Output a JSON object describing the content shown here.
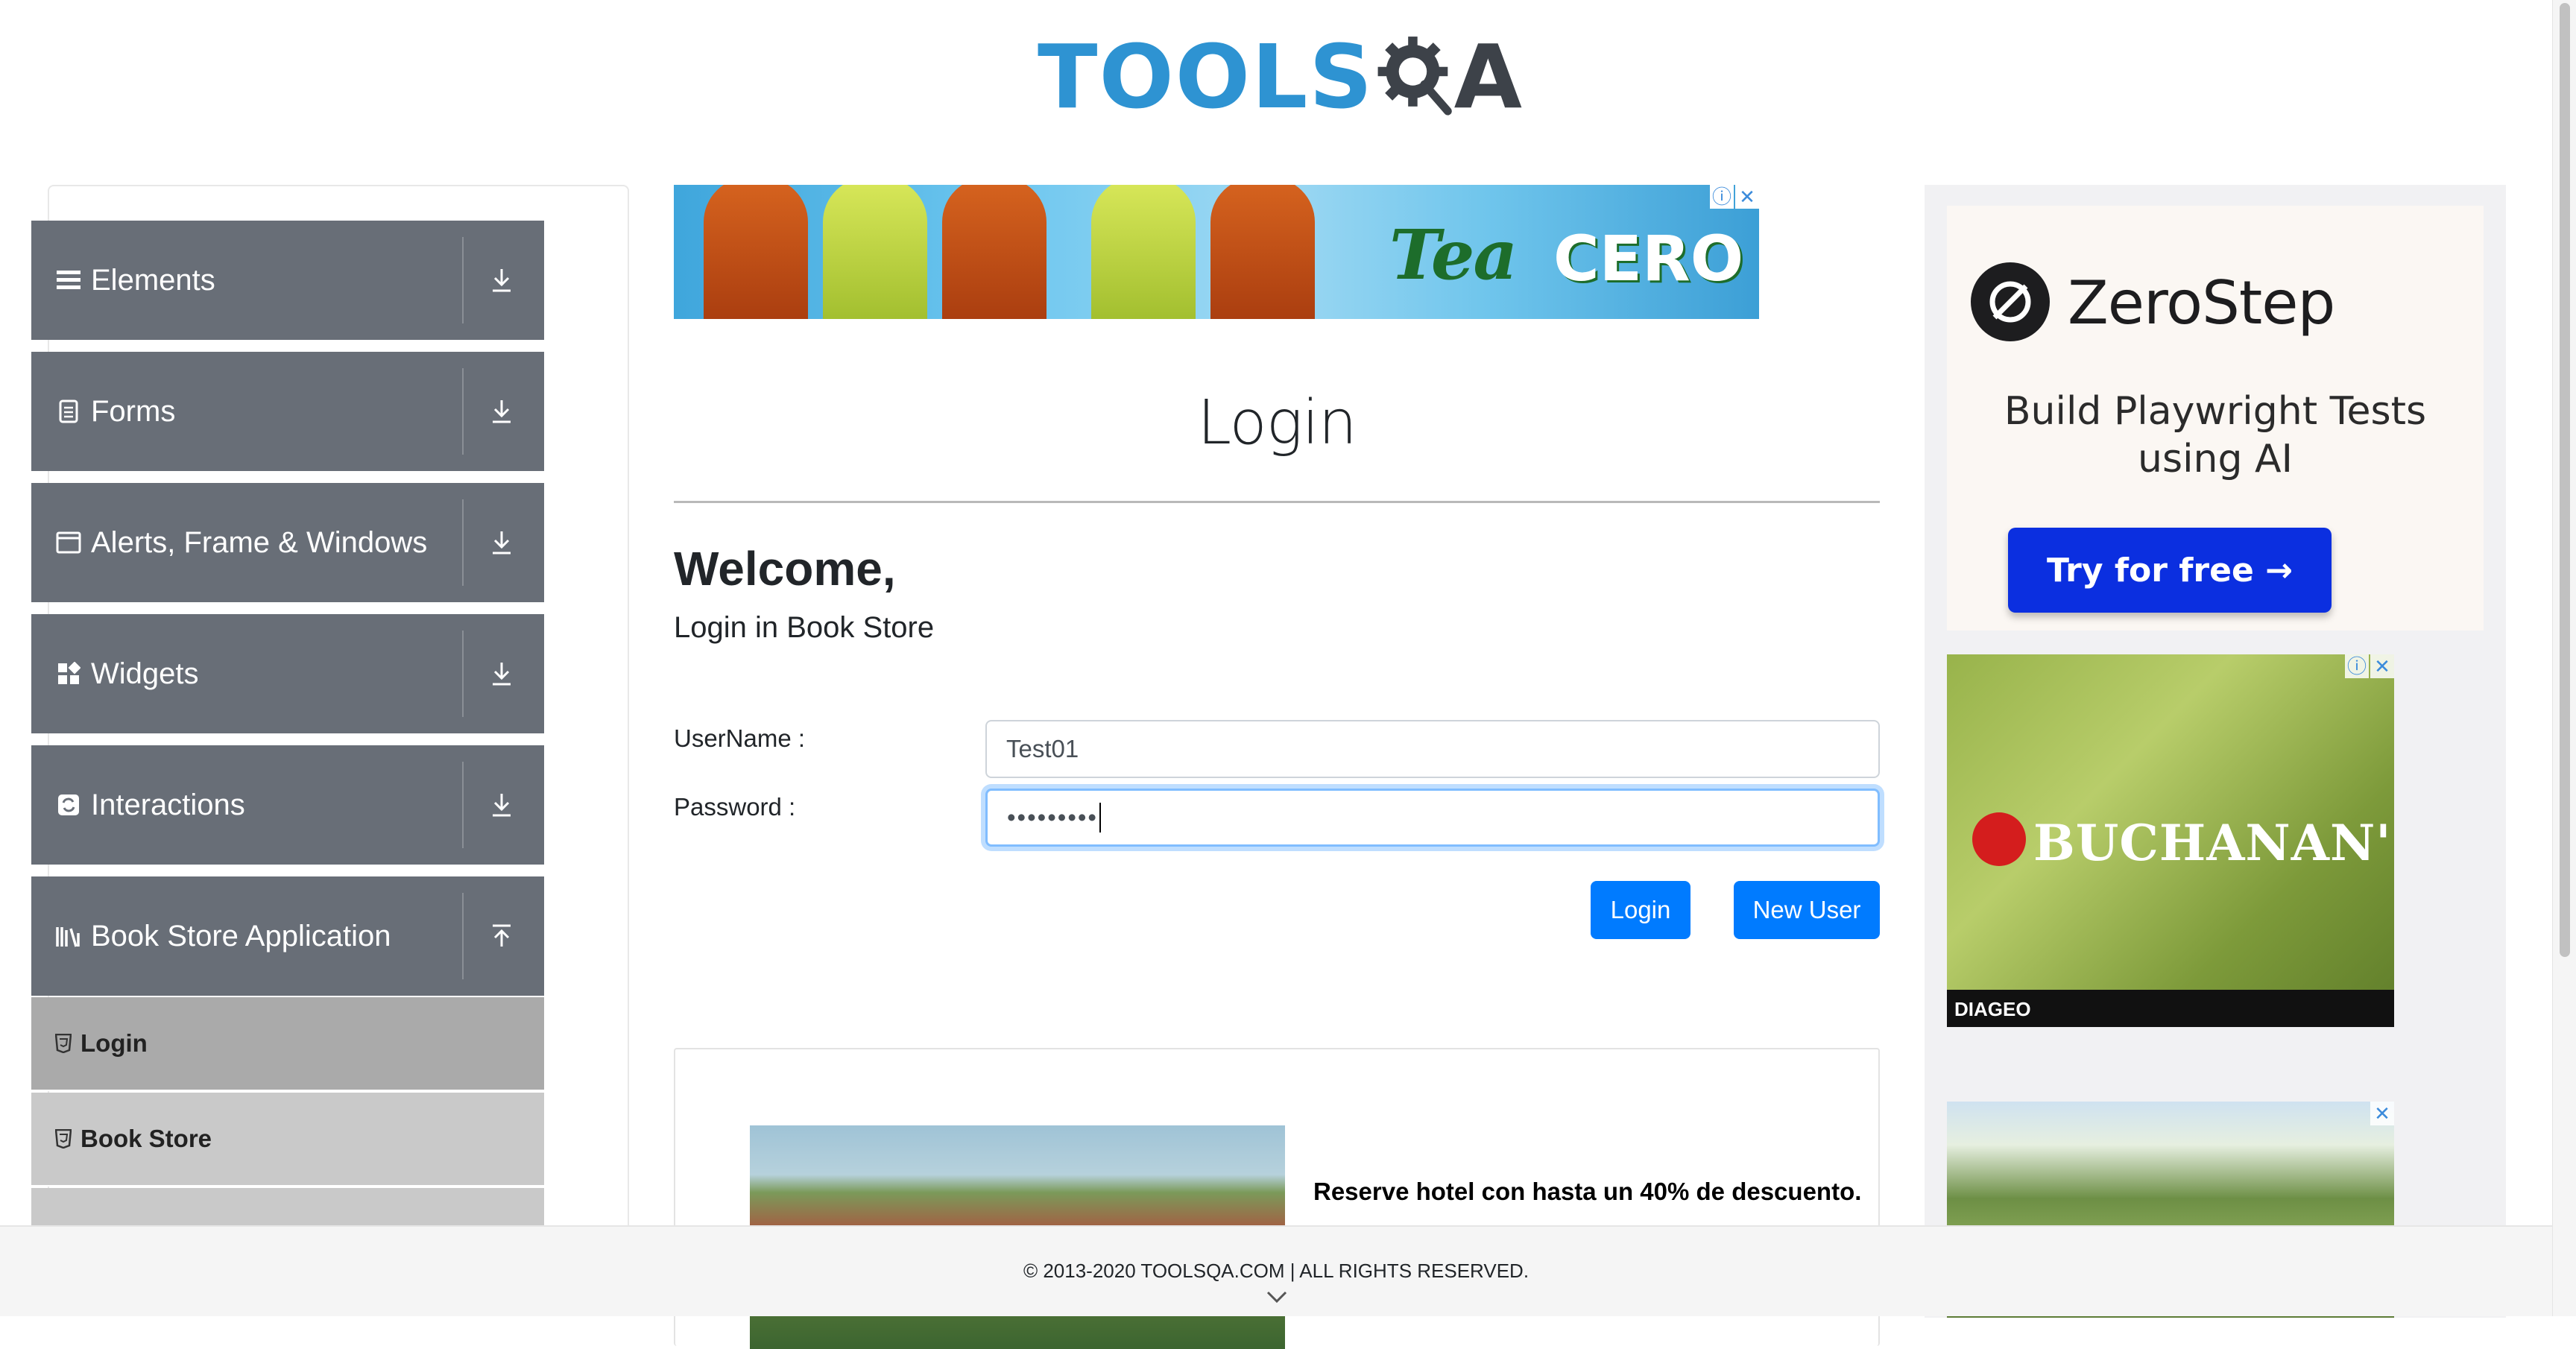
{
  "header": {
    "logo_tools": "TOOLS",
    "logo_qa": "A"
  },
  "sidebar": {
    "groups": [
      {
        "label": "Elements",
        "icon": "hamburger-icon",
        "toggle": "download-arrow-icon"
      },
      {
        "label": "Forms",
        "icon": "document-icon",
        "toggle": "download-arrow-icon"
      },
      {
        "label": "Alerts, Frame & Windows",
        "icon": "window-icon",
        "toggle": "download-arrow-icon"
      },
      {
        "label": "Widgets",
        "icon": "widgets-icon",
        "toggle": "download-arrow-icon"
      },
      {
        "label": "Interactions",
        "icon": "interactions-icon",
        "toggle": "download-arrow-icon"
      },
      {
        "label": "Book Store Application",
        "icon": "library-icon",
        "toggle": "upload-arrow-icon"
      }
    ],
    "book_store_items": [
      {
        "label": "Login",
        "active": true
      },
      {
        "label": "Book Store",
        "active": false
      }
    ]
  },
  "main": {
    "title": "Login",
    "welcome": "Welcome,",
    "subtitle": "Login in Book Store",
    "username_label": "UserName :",
    "username_value": "Test01",
    "password_label": "Password :",
    "password_mask": "•••••••••",
    "login_button": "Login",
    "new_user_button": "New User",
    "promo_text": "Reserve hotel con hasta un 40% de descuento."
  },
  "ads": {
    "top_banner_brand": "Tea",
    "top_banner_brand2": "CERO",
    "zerostep_name": "ZeroStep",
    "zerostep_tagline": "Build Playwright Tests using AI",
    "zerostep_cta": "Try for free →",
    "buchanans_brand": "BUCHANAN'S",
    "buchanans_company": "DIAGEO"
  },
  "footer": {
    "text": "© 2013-2020 TOOLSQA.COM | ALL RIGHTS RESERVED."
  },
  "colors": {
    "sidebar_group": "#686e77",
    "subitem": "#c9c9c9",
    "subitem_active": "#aaaaaa",
    "primary_button": "#007bff",
    "logo_blue": "#2e93d2"
  }
}
